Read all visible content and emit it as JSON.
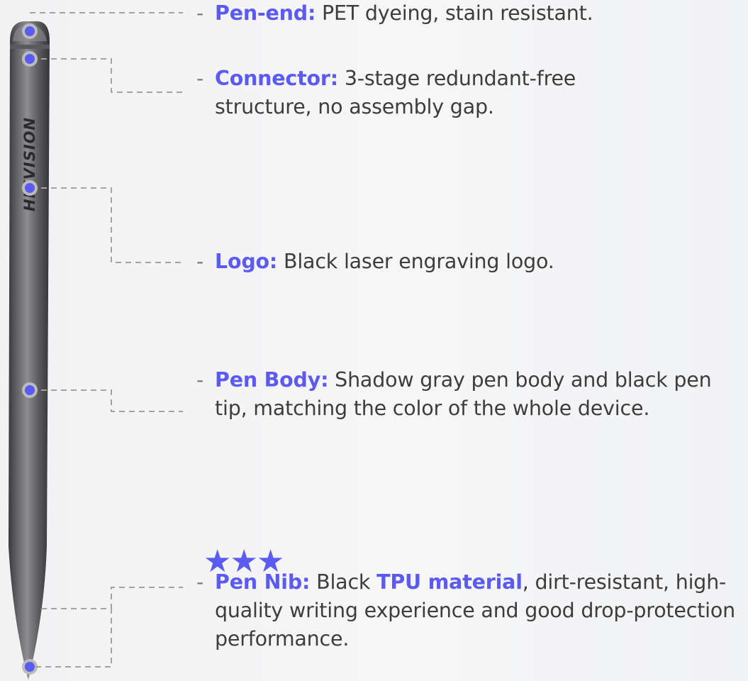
{
  "brand": {
    "logo_text": "HIKVISION",
    "accent_color": "#5b5bf2"
  },
  "features": [
    {
      "label": "Pen-end:",
      "text": "PET dyeing, stain resistant."
    },
    {
      "label": "Connector:",
      "text": "3-stage redundant-free structure, no assembly gap."
    },
    {
      "label": "Logo:",
      "text": "Black laser engraving logo."
    },
    {
      "label": "Pen Body:",
      "text": "Shadow gray pen body and black pen tip, matching the color of the whole device."
    },
    {
      "label": "Pen Nib:",
      "text_before": "Black",
      "highlight": "TPU material",
      "text_after": ", dirt-resistant, high-quality writing experience and good drop-protection performance.",
      "stars": "★★★"
    }
  ],
  "bullet_dash": "-"
}
